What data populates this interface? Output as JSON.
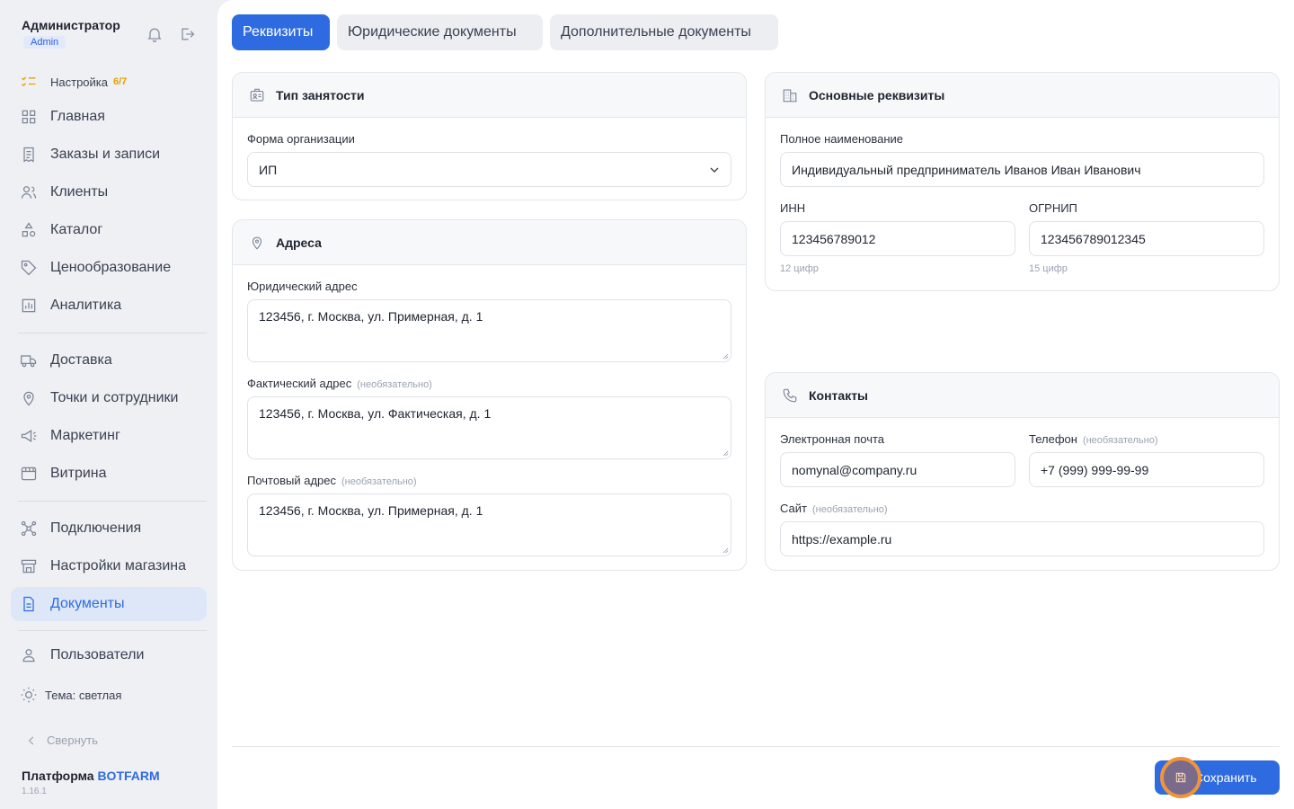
{
  "user": {
    "name": "Администратор",
    "role": "Admin"
  },
  "sidebar": {
    "setup": {
      "label": "Настройка",
      "progress": "6/7"
    },
    "items": [
      {
        "label": "Главная",
        "icon": "grid-icon"
      },
      {
        "label": "Заказы и записи",
        "icon": "receipt-icon"
      },
      {
        "label": "Клиенты",
        "icon": "users-icon"
      },
      {
        "label": "Каталог",
        "icon": "shapes-icon"
      },
      {
        "label": "Ценообразование",
        "icon": "tag-icon"
      },
      {
        "label": "Аналитика",
        "icon": "chart-icon"
      },
      {
        "label": "Доставка",
        "icon": "truck-icon"
      },
      {
        "label": "Точки и сотрудники",
        "icon": "map-pin-icon"
      },
      {
        "label": "Маркетинг",
        "icon": "megaphone-icon"
      },
      {
        "label": "Витрина",
        "icon": "storefront-icon"
      },
      {
        "label": "Подключения",
        "icon": "network-icon"
      },
      {
        "label": "Настройки магазина",
        "icon": "store-icon"
      },
      {
        "label": "Документы",
        "icon": "document-icon"
      },
      {
        "label": "Пользователи",
        "icon": "user-icon"
      }
    ],
    "theme": "Тема: светлая",
    "collapse": "Свернуть",
    "platform_prefix": "Платформа",
    "platform_brand": "BOTFARM",
    "version": "1.16.1"
  },
  "tabs": [
    "Реквизиты",
    "Юридические документы",
    "Дополнительные документы"
  ],
  "employment": {
    "title": "Тип занятости",
    "org_form_label": "Форма организации",
    "org_form_value": "ИП"
  },
  "addresses": {
    "title": "Адреса",
    "legal_label": "Юридический адрес",
    "legal_value": "123456, г. Москва, ул. Примерная, д. 1",
    "actual_label": "Фактический адрес",
    "actual_value": "123456, г. Москва, ул. Фактическая, д. 1",
    "postal_label": "Почтовый адрес",
    "postal_value": "123456, г. Москва, ул. Примерная, д. 1",
    "optional": "(необязательно)"
  },
  "requisites": {
    "title": "Основные реквизиты",
    "full_name_label": "Полное наименование",
    "full_name_value": "Индивидуальный предприниматель Иванов Иван Иванович",
    "inn_label": "ИНН",
    "inn_value": "123456789012",
    "inn_hint": "12 цифр",
    "ogrnip_label": "ОГРНИП",
    "ogrnip_value": "123456789012345",
    "ogrnip_hint": "15 цифр"
  },
  "contacts": {
    "title": "Контакты",
    "email_label": "Электронная почта",
    "email_value": "nomynal@company.ru",
    "phone_label": "Телефон",
    "phone_value": "+7 (999) 999-99-99",
    "site_label": "Сайт",
    "site_value": "https://example.ru",
    "optional": "(необязательно)"
  },
  "save_label": "Сохранить"
}
